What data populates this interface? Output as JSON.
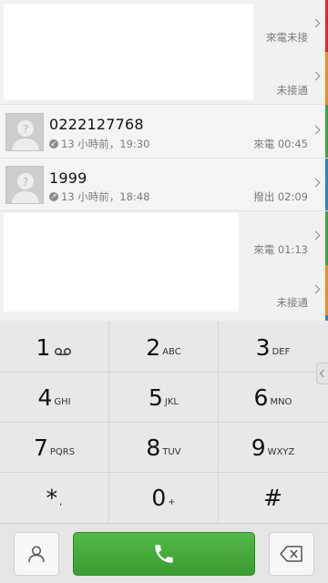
{
  "call_log": [
    {
      "status": "來電未接"
    },
    {
      "status": "未接通"
    },
    {
      "number": "0222127768",
      "time": "13 小時前，19:30",
      "status": "來電 00:45"
    },
    {
      "number": "1999",
      "time": "13 小時前，18:48",
      "status": "撥出 02:09"
    },
    {
      "status": "來電 01:13"
    },
    {
      "status": "未接通"
    }
  ],
  "keypad": [
    {
      "digit": "1",
      "letters": ""
    },
    {
      "digit": "2",
      "letters": "ABC"
    },
    {
      "digit": "3",
      "letters": "DEF"
    },
    {
      "digit": "4",
      "letters": "GHI"
    },
    {
      "digit": "5",
      "letters": "JKL"
    },
    {
      "digit": "6",
      "letters": "MNO"
    },
    {
      "digit": "7",
      "letters": "PQRS"
    },
    {
      "digit": "8",
      "letters": "TUV"
    },
    {
      "digit": "9",
      "letters": "WXYZ"
    },
    {
      "digit": "*",
      "letters": ","
    },
    {
      "digit": "0",
      "letters": "+"
    },
    {
      "digit": "#",
      "letters": ""
    }
  ],
  "icons": {
    "voicemail": "voicemail-icon",
    "contacts": "contacts-icon",
    "call": "phone-icon",
    "backspace": "backspace-icon"
  },
  "colors": {
    "missed": "#e0262a",
    "no_answer": "#f08a1c",
    "incoming": "#3da336",
    "outgoing": "#2f7fc4",
    "call_button": "#45aa3b"
  }
}
